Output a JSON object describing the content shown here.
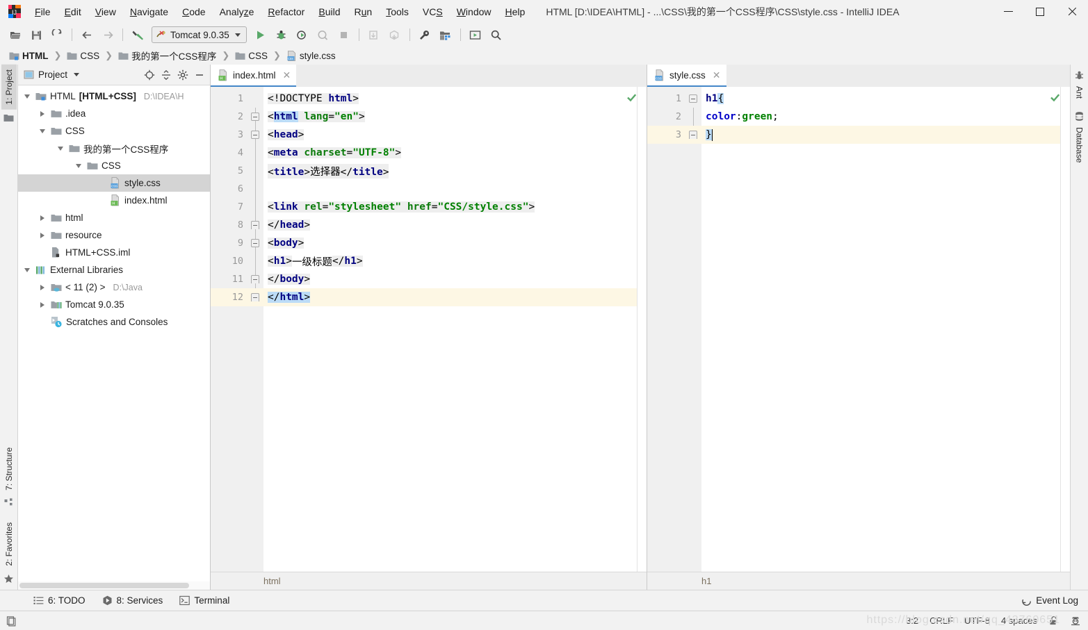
{
  "window": {
    "title": "HTML [D:\\IDEA\\HTML] - ...\\CSS\\我的第一个CSS程序\\CSS\\style.css - IntelliJ IDEA",
    "minimize_label": "Minimize",
    "maximize_label": "Maximize",
    "close_label": "Close"
  },
  "menu": [
    {
      "label": "File"
    },
    {
      "label": "Edit"
    },
    {
      "label": "View"
    },
    {
      "label": "Navigate"
    },
    {
      "label": "Code"
    },
    {
      "label": "Analyze"
    },
    {
      "label": "Refactor"
    },
    {
      "label": "Build"
    },
    {
      "label": "Run"
    },
    {
      "label": "Tools"
    },
    {
      "label": "VCS"
    },
    {
      "label": "Window"
    },
    {
      "label": "Help"
    }
  ],
  "toolbar": {
    "open_icon": "open-folder-icon",
    "save_icon": "save-icon",
    "sync_icon": "refresh-icon",
    "back_icon": "arrow-left-icon",
    "forward_icon": "arrow-right-icon",
    "build_icon": "hammer-icon",
    "run_config": "Tomcat 9.0.35",
    "run_icon": "run-play-icon",
    "debug_icon": "debug-bug-icon",
    "run_coverage_icon": "run-with-coverage-icon",
    "profile_icon": "profile-icon",
    "stop_icon": "stop-icon",
    "update_icon": "update-project-icon",
    "commit_icon": "commit-icon",
    "settings_icon": "wrench-icon",
    "project_structure_icon": "project-structure-icon",
    "preview_icon": "open-in-browser-icon",
    "search_icon": "search-everywhere-icon"
  },
  "breadcrumb": [
    {
      "label": "HTML",
      "icon": "module-icon",
      "bold": true
    },
    {
      "label": "CSS",
      "icon": "folder-icon",
      "bold": false
    },
    {
      "label": "我的第一个CSS程序",
      "icon": "folder-icon",
      "bold": false
    },
    {
      "label": "CSS",
      "icon": "folder-icon",
      "bold": false
    },
    {
      "label": "style.css",
      "icon": "css-file-icon",
      "bold": false
    }
  ],
  "left_strip": {
    "tabs": [
      {
        "label": "1: Project",
        "icon": "project-icon",
        "selected": true
      },
      {
        "label": "7: Structure",
        "icon": "structure-icon",
        "selected": false
      },
      {
        "label": "2: Favorites",
        "icon": "star-icon",
        "selected": false
      }
    ]
  },
  "right_strip": {
    "tabs": [
      {
        "label": "Ant",
        "icon": "ant-icon"
      },
      {
        "label": "Database",
        "icon": "database-icon"
      }
    ]
  },
  "project_panel": {
    "title": "Project",
    "view_dropdown_icon": "chevron-down-icon",
    "actions": [
      {
        "icon": "locate-icon",
        "name": "select-opened-file-button"
      },
      {
        "icon": "collapse-all-icon",
        "name": "collapse-all-button"
      },
      {
        "icon": "gear-icon",
        "name": "settings-button"
      },
      {
        "icon": "hide-icon",
        "name": "hide-button"
      }
    ],
    "tree": [
      {
        "label": "HTML",
        "suffix": "[HTML+CSS]",
        "path": "D:\\IDEA\\H",
        "indent": 0,
        "state": "open",
        "icon": "module-icon",
        "selected": false
      },
      {
        "label": ".idea",
        "suffix": "",
        "path": "",
        "indent": 1,
        "state": "closed",
        "icon": "folder-icon",
        "selected": false
      },
      {
        "label": "CSS",
        "suffix": "",
        "path": "",
        "indent": 1,
        "state": "open",
        "icon": "folder-icon",
        "selected": false
      },
      {
        "label": "我的第一个CSS程序",
        "suffix": "",
        "path": "",
        "indent": 2,
        "state": "open",
        "icon": "folder-icon",
        "selected": false
      },
      {
        "label": "CSS",
        "suffix": "",
        "path": "",
        "indent": 3,
        "state": "open",
        "icon": "folder-icon",
        "selected": false
      },
      {
        "label": "style.css",
        "suffix": "",
        "path": "",
        "indent": 4,
        "state": "leaf",
        "icon": "css-file-icon",
        "selected": true
      },
      {
        "label": "index.html",
        "suffix": "",
        "path": "",
        "indent": 4,
        "state": "leaf",
        "icon": "html-file-icon",
        "selected": false
      },
      {
        "label": "html",
        "suffix": "",
        "path": "",
        "indent": 1,
        "state": "closed",
        "icon": "folder-icon",
        "selected": false
      },
      {
        "label": "resource",
        "suffix": "",
        "path": "",
        "indent": 1,
        "state": "closed",
        "icon": "folder-icon",
        "selected": false
      },
      {
        "label": "HTML+CSS.iml",
        "suffix": "",
        "path": "",
        "indent": 1,
        "state": "leaf",
        "icon": "iml-file-icon",
        "selected": false
      },
      {
        "label": "External Libraries",
        "suffix": "",
        "path": "",
        "indent": 0,
        "state": "open",
        "icon": "library-icon",
        "selected": false
      },
      {
        "label": "< 11 (2) >",
        "suffix": "",
        "path": "D:\\Java",
        "indent": 1,
        "state": "closed",
        "icon": "jdk-icon",
        "selected": false
      },
      {
        "label": "Tomcat 9.0.35",
        "suffix": "",
        "path": "",
        "indent": 1,
        "state": "closed",
        "icon": "library-icon",
        "selected": false
      },
      {
        "label": "Scratches and Consoles",
        "suffix": "",
        "path": "",
        "indent": 0,
        "state": "leaf",
        "icon": "scratches-icon",
        "selected": false
      }
    ]
  },
  "editor_html": {
    "tab": {
      "label": "index.html",
      "icon": "html-file-icon",
      "close_icon": "close-icon"
    },
    "inspection_status": "ok",
    "breadcrumb": "html",
    "lines": [
      {
        "n": "1",
        "indent": 0
      },
      {
        "n": "2",
        "indent": 0
      },
      {
        "n": "3",
        "indent": 0
      },
      {
        "n": "4",
        "indent": 0
      },
      {
        "n": "5",
        "indent": 0
      },
      {
        "n": "6",
        "indent": 0
      },
      {
        "n": "7",
        "indent": 0
      },
      {
        "n": "8",
        "indent": 0
      },
      {
        "n": "9",
        "indent": 0
      },
      {
        "n": "10",
        "indent": 0
      },
      {
        "n": "11",
        "indent": 0
      },
      {
        "n": "12",
        "indent": 0
      }
    ],
    "code_text": [
      "<!DOCTYPE html>",
      "<html lang=\"en\">",
      "<head>",
      "    <meta charset=\"UTF-8\">",
      "    <title>选择器</title>",
      "",
      "    <link rel=\"stylesheet\" href=\"CSS/style.css\">",
      "</head>",
      "<body>",
      "<h1>一级标题</h1>",
      "</body>",
      "</html>"
    ]
  },
  "editor_css": {
    "tab": {
      "label": "style.css",
      "icon": "css-file-icon",
      "close_icon": "close-icon"
    },
    "inspection_status": "ok",
    "breadcrumb": "h1",
    "color_swatch": "#008000",
    "lines": [
      {
        "n": "1"
      },
      {
        "n": "2"
      },
      {
        "n": "3"
      }
    ],
    "code_text": [
      "h1 {",
      "    color: green;",
      "}"
    ]
  },
  "bottom_bar": {
    "items": [
      {
        "label": "6: TODO",
        "icon": "todo-icon"
      },
      {
        "label": "8: Services",
        "icon": "services-icon"
      },
      {
        "label": "Terminal",
        "icon": "terminal-icon"
      }
    ],
    "event_log": {
      "label": "Event Log",
      "icon": "event-log-icon"
    }
  },
  "status_bar": {
    "memory_icon": "memory-indicator-icon",
    "caret_position": "3:2",
    "line_separator": "CRLF",
    "encoding": "UTF-8",
    "indent": "4 spaces",
    "lock_icon": "unlocked-icon",
    "inspector_icon": "inspector-icon",
    "watermark": "https://blog.csdn.net/qq_43760651"
  },
  "colors": {
    "accent": "#4386c8",
    "selection": "#bcdcf7",
    "caret_line": "#fdf7e4",
    "tree_selection": "#d4d4d4",
    "tag": "#000080",
    "attr": "#0b7b0b",
    "value": "#008000",
    "property": "#0000c8",
    "ok_green": "#59a869"
  }
}
